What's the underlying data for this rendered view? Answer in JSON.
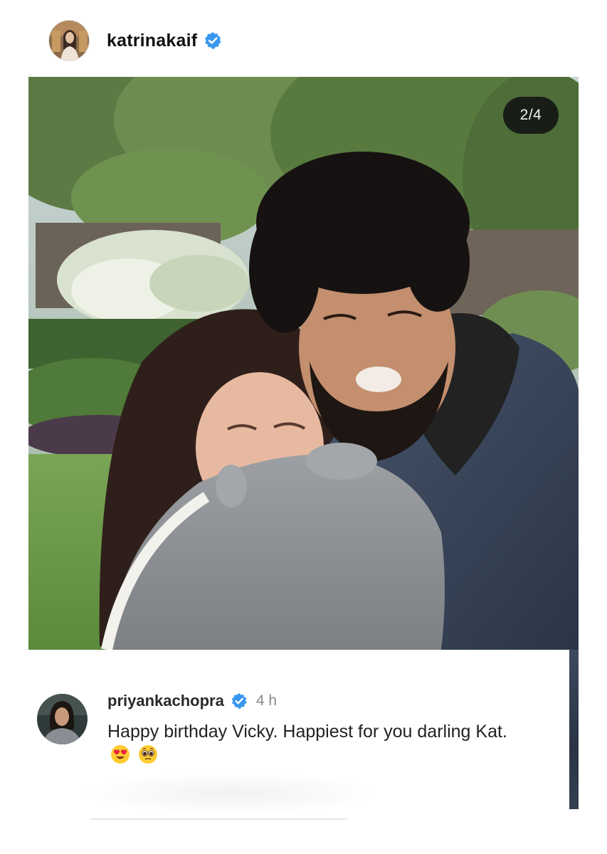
{
  "post": {
    "username": "katrinakaif",
    "verified": true,
    "carousel_counter": "2/4"
  },
  "comment": {
    "username": "priyankachopra",
    "verified": true,
    "time": "4 h",
    "text": "Happy birthday Vicky. Happiest for you darling Kat.",
    "emojis": [
      "heart-eyes-emoji",
      "pleading-face-emoji"
    ]
  },
  "colors": {
    "verified_badge": "#3897f0",
    "counter_bg": "#121212"
  }
}
